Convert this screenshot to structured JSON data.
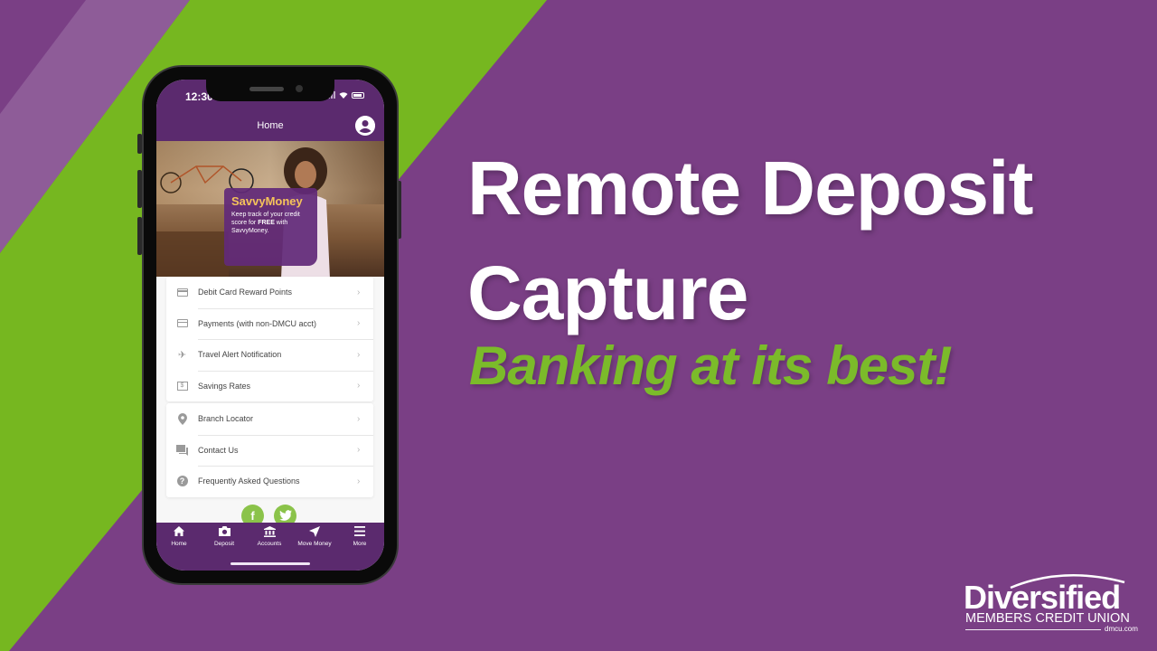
{
  "colors": {
    "background_purple": "#7a3f85",
    "stripe_light_purple": "#8e5c98",
    "stripe_green": "#76b720",
    "app_purple": "#5b2a6e",
    "promo_title_yellow": "#f5c35a",
    "tagline_green": "#7bbb2a",
    "social_green": "#8bc34a"
  },
  "hero": {
    "title_line1": "Remote Deposit",
    "title_line2": "Capture",
    "tagline": "Banking at its best!"
  },
  "logo": {
    "name": "Diversified",
    "subtitle": "MEMBERS CREDIT UNION",
    "url": "dmcu.com"
  },
  "phone": {
    "status_bar": {
      "time": "12:30"
    },
    "header": {
      "title": "Home",
      "profile_icon": "account-circle-icon"
    },
    "promo": {
      "title": "SavvyMoney",
      "text_before": "Keep track of your credit score for ",
      "text_bold": "FREE",
      "text_after": " with SavvyMoney."
    },
    "menu_group1": [
      {
        "label": "Debit Card Reward Points",
        "icon": "credit-card-icon"
      },
      {
        "label": "Payments (with non-DMCU acct)",
        "icon": "credit-card-icon"
      },
      {
        "label": "Travel Alert Notification",
        "icon": "airplane-icon"
      },
      {
        "label": "Savings Rates",
        "icon": "dollar-icon"
      }
    ],
    "menu_group2": [
      {
        "label": "Branch Locator",
        "icon": "location-pin-icon"
      },
      {
        "label": "Contact Us",
        "icon": "chat-icon"
      },
      {
        "label": "Frequently Asked Questions",
        "icon": "help-icon"
      }
    ],
    "chevron": "›",
    "social": {
      "facebook": "f",
      "twitter": "t"
    },
    "tabs": [
      {
        "label": "Home",
        "icon": "⌂"
      },
      {
        "label": "Deposit",
        "icon": "◙"
      },
      {
        "label": "Accounts",
        "icon": "🏛"
      },
      {
        "label": "Move Money",
        "icon": "➤"
      },
      {
        "label": "More",
        "icon": "≡"
      }
    ]
  }
}
